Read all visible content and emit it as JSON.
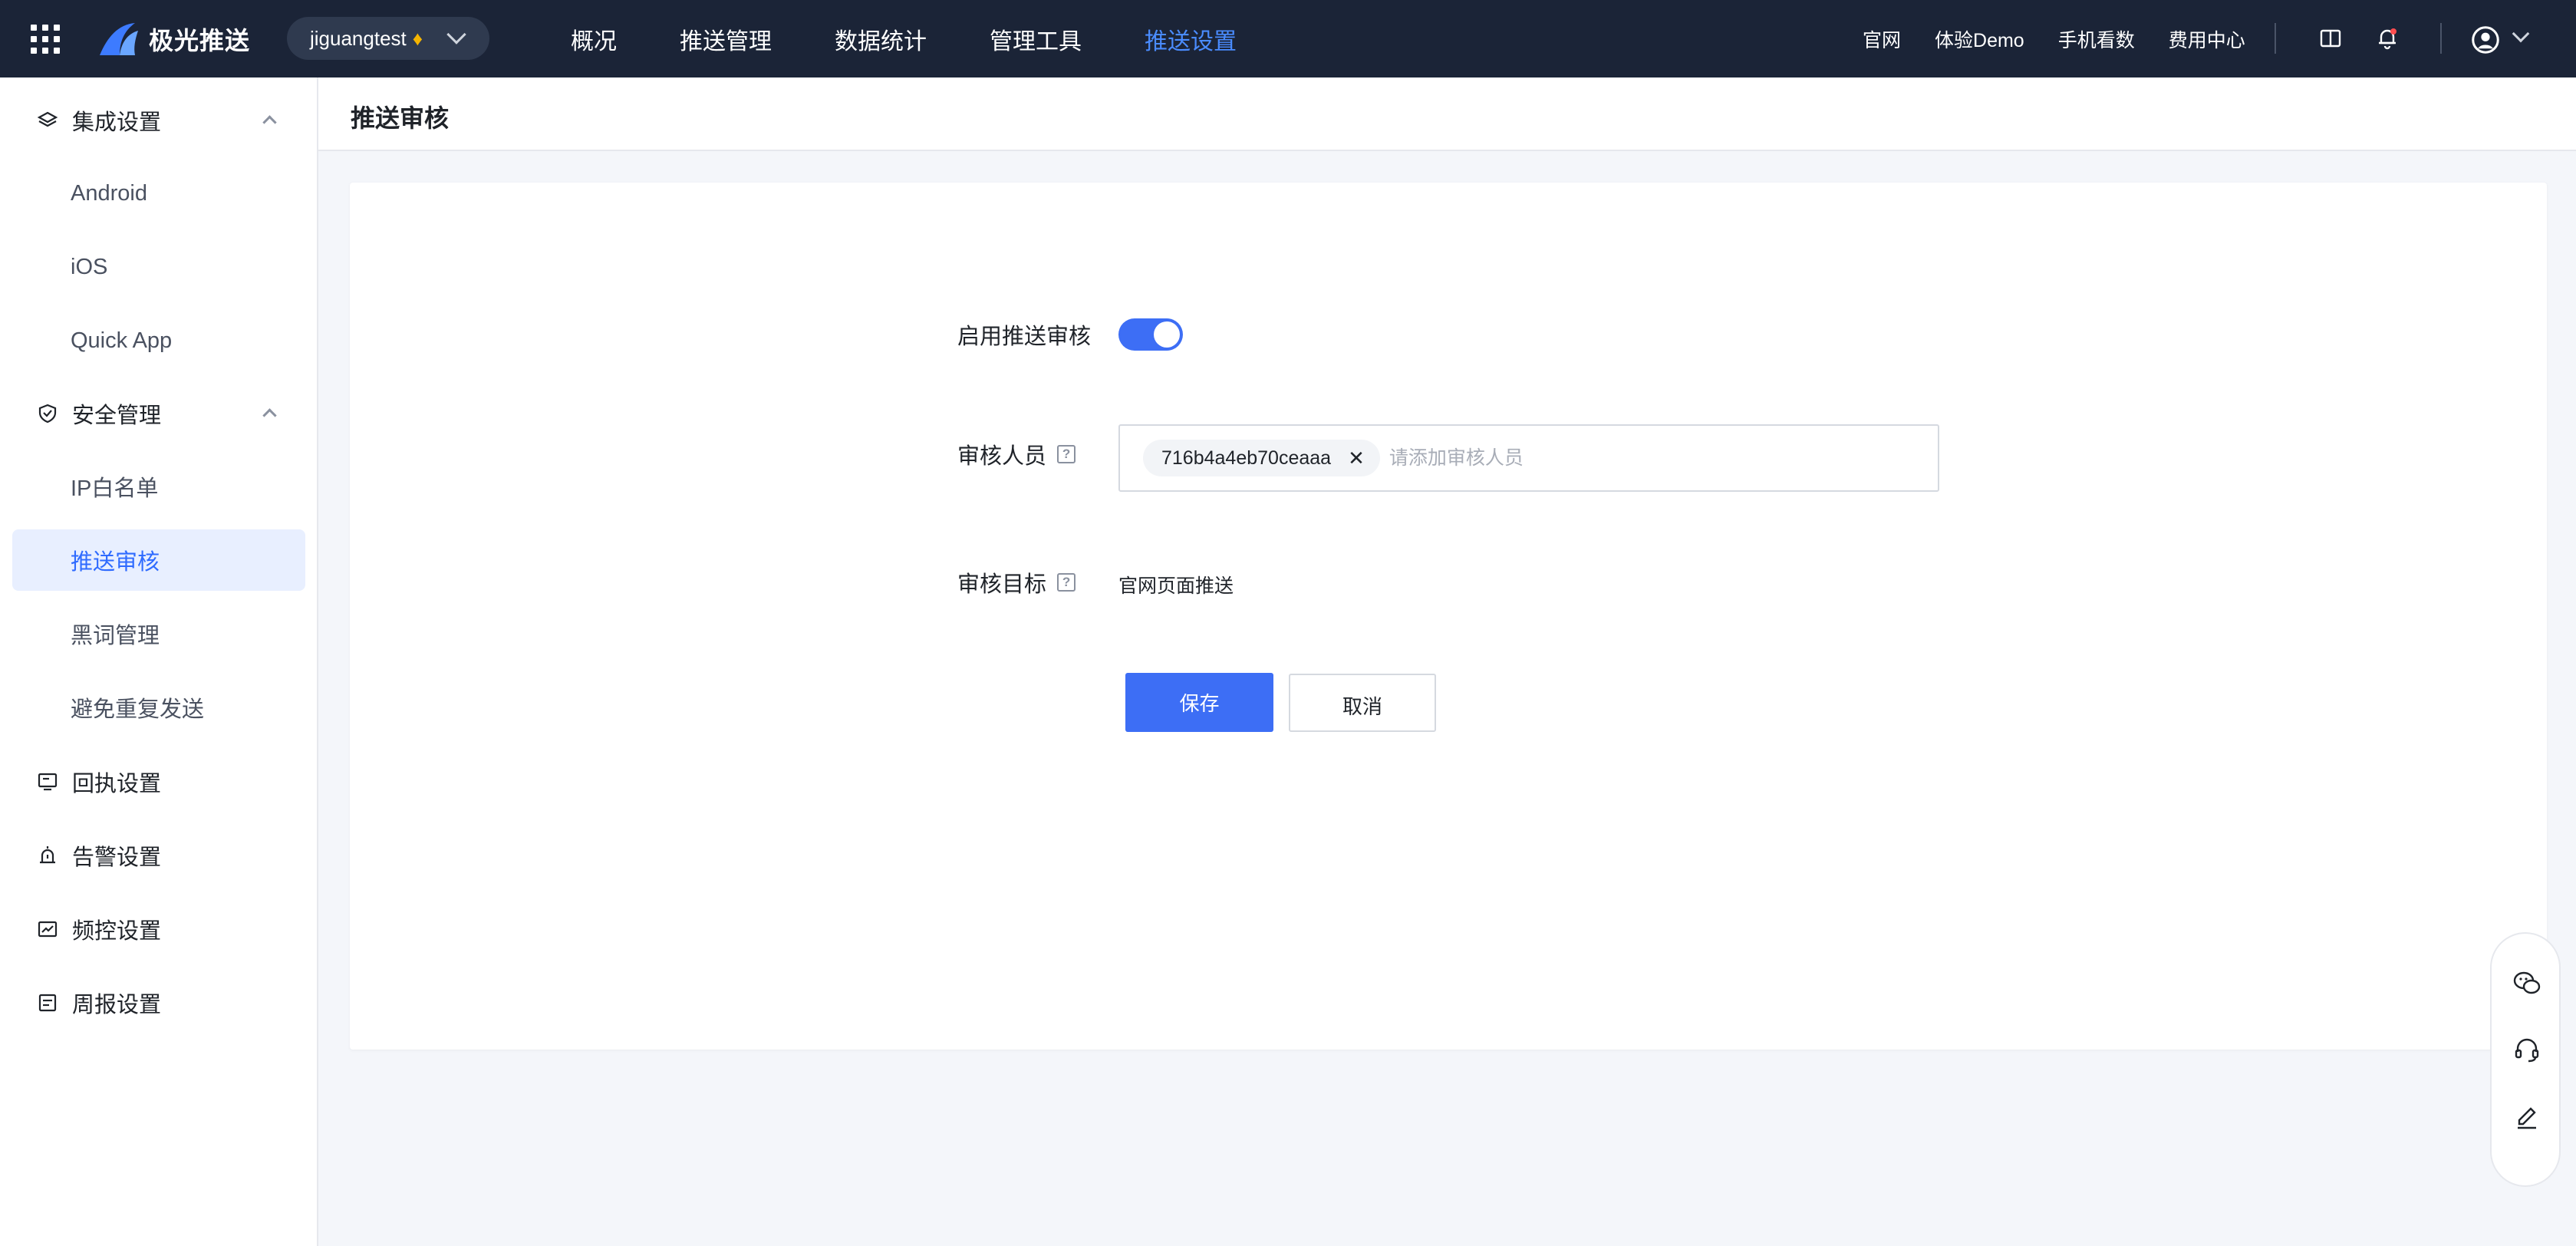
{
  "topbar": {
    "brand": "极光推送",
    "app_select": "jiguangtest",
    "nav": [
      "概况",
      "推送管理",
      "数据统计",
      "管理工具",
      "推送设置"
    ],
    "active_nav_index": 4,
    "links": [
      "官网",
      "体验Demo",
      "手机看数",
      "费用中心"
    ]
  },
  "sidebar": {
    "groups": [
      {
        "label": "集成设置",
        "icon": "layers-icon",
        "expanded": true,
        "items": [
          "Android",
          "iOS",
          "Quick App"
        ]
      },
      {
        "label": "安全管理",
        "icon": "shield-icon",
        "expanded": true,
        "items": [
          "IP白名单",
          "推送审核",
          "黑词管理",
          "避免重复发送"
        ]
      },
      {
        "label": "回执设置",
        "icon": "monitor-icon",
        "items": []
      },
      {
        "label": "告警设置",
        "icon": "alarm-icon",
        "items": []
      },
      {
        "label": "频控设置",
        "icon": "chart-card-icon",
        "items": []
      },
      {
        "label": "周报设置",
        "icon": "report-icon",
        "items": []
      }
    ],
    "active_item": "推送审核"
  },
  "page": {
    "title": "推送审核",
    "enable_label": "启用推送审核",
    "enable_on": true,
    "reviewer_label": "审核人员",
    "reviewer_tag": "716b4a4eb70ceaaa",
    "reviewer_placeholder": "请添加审核人员",
    "target_label": "审核目标",
    "target_value": "官网页面推送",
    "save_label": "保存",
    "cancel_label": "取消"
  },
  "colors": {
    "topbar_bg": "#1b2437",
    "accent": "#3d6ef5",
    "active_nav": "#4a8cff",
    "active_item_bg": "#e8efff"
  },
  "float_icons": [
    "wechat-icon",
    "customer-service-icon",
    "edit-icon"
  ]
}
